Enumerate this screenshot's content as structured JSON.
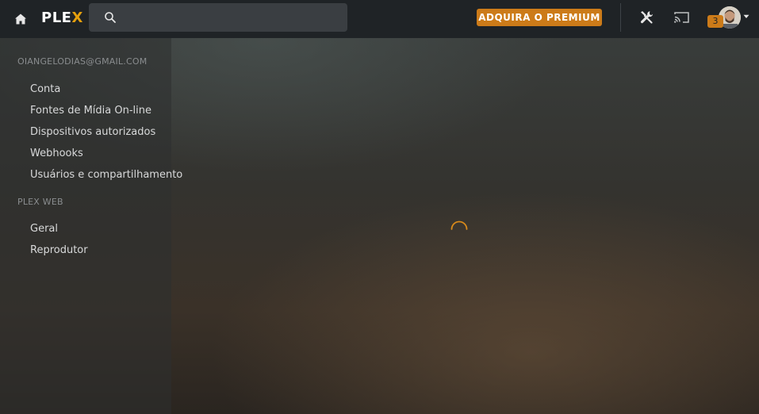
{
  "topbar": {
    "logo_main": "PLE",
    "logo_accent": "X",
    "search_placeholder": "",
    "premium_label": "ADQUIRA O PREMIUM",
    "notification_count": "3",
    "accent_color": "#cc7b19"
  },
  "icons": {
    "home": "home-icon",
    "search": "search-icon",
    "tools": "wrench-screwdriver-icon",
    "cast": "cast-icon",
    "avatar": "avatar",
    "caret": "caret-down-icon",
    "spinner": "loading-spinner"
  },
  "sidebar": {
    "account_section": "OIANGELODIAS@GMAIL.COM",
    "account_items": [
      {
        "label": "Conta"
      },
      {
        "label": "Fontes de Mídia On-line"
      },
      {
        "label": "Dispositivos autorizados"
      },
      {
        "label": "Webhooks"
      },
      {
        "label": "Usuários e compartilhamento"
      }
    ],
    "web_section": "PLEX WEB",
    "web_items": [
      {
        "label": "Geral"
      },
      {
        "label": "Reprodutor"
      }
    ]
  }
}
